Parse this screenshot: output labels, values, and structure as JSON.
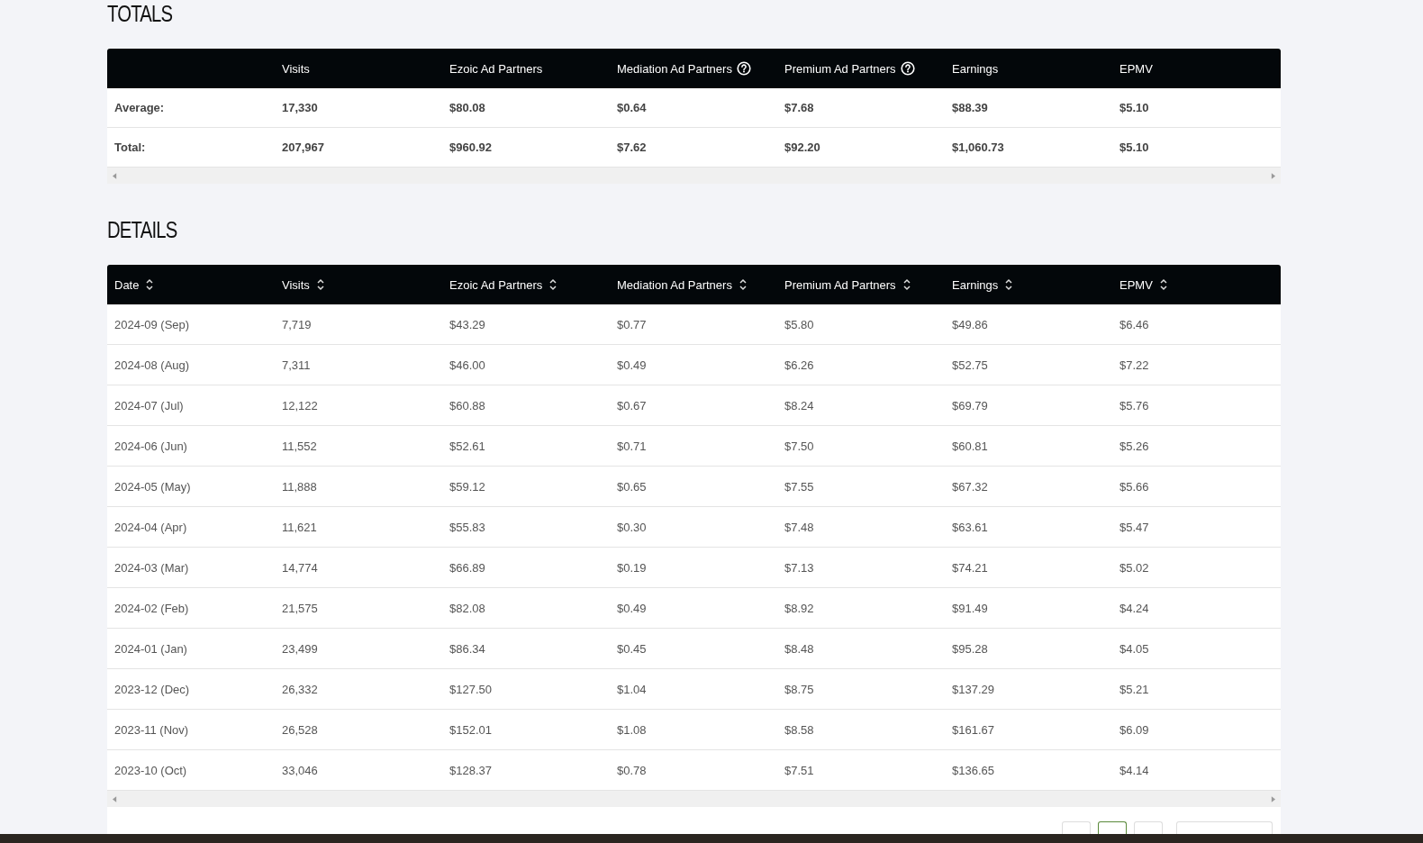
{
  "totals": {
    "title": "TOTALS",
    "columns": [
      {
        "help": false
      },
      {
        "label": "Visits",
        "help": false
      },
      {
        "label": "Ezoic Ad Partners",
        "help": false
      },
      {
        "label": "Mediation Ad Partners",
        "help": true
      },
      {
        "label": "Premium Ad Partners",
        "help": true
      },
      {
        "label": "Earnings",
        "help": false
      },
      {
        "label": "EPMV",
        "help": false
      }
    ],
    "rows": [
      [
        "Average:",
        "17,330",
        "$80.08",
        "$0.64",
        "$7.68",
        "$88.39",
        "$5.10"
      ],
      [
        "Total:",
        "207,967",
        "$960.92",
        "$7.62",
        "$92.20",
        "$1,060.73",
        "$5.10"
      ]
    ]
  },
  "details": {
    "title": "DETAILS",
    "columns": [
      "Date",
      "Visits",
      "Ezoic Ad Partners",
      "Mediation Ad Partners",
      "Premium Ad Partners",
      "Earnings",
      "EPMV"
    ],
    "rows": [
      [
        "2024-09 (Sep)",
        "7,719",
        "$43.29",
        "$0.77",
        "$5.80",
        "$49.86",
        "$6.46"
      ],
      [
        "2024-08 (Aug)",
        "7,311",
        "$46.00",
        "$0.49",
        "$6.26",
        "$52.75",
        "$7.22"
      ],
      [
        "2024-07 (Jul)",
        "12,122",
        "$60.88",
        "$0.67",
        "$8.24",
        "$69.79",
        "$5.76"
      ],
      [
        "2024-06 (Jun)",
        "11,552",
        "$52.61",
        "$0.71",
        "$7.50",
        "$60.81",
        "$5.26"
      ],
      [
        "2024-05 (May)",
        "11,888",
        "$59.12",
        "$0.65",
        "$7.55",
        "$67.32",
        "$5.66"
      ],
      [
        "2024-04 (Apr)",
        "11,621",
        "$55.83",
        "$0.30",
        "$7.48",
        "$63.61",
        "$5.47"
      ],
      [
        "2024-03 (Mar)",
        "14,774",
        "$66.89",
        "$0.19",
        "$7.13",
        "$74.21",
        "$5.02"
      ],
      [
        "2024-02 (Feb)",
        "21,575",
        "$82.08",
        "$0.49",
        "$8.92",
        "$91.49",
        "$4.24"
      ],
      [
        "2024-01 (Jan)",
        "23,499",
        "$86.34",
        "$0.45",
        "$8.48",
        "$95.28",
        "$4.05"
      ],
      [
        "2023-12 (Dec)",
        "26,332",
        "$127.50",
        "$1.04",
        "$8.75",
        "$137.29",
        "$5.21"
      ],
      [
        "2023-11 (Nov)",
        "26,528",
        "$152.01",
        "$1.08",
        "$8.58",
        "$161.67",
        "$6.09"
      ],
      [
        "2023-10 (Oct)",
        "33,046",
        "$128.37",
        "$0.78",
        "$7.51",
        "$136.65",
        "$4.14"
      ]
    ]
  },
  "pagination": {
    "pages": [
      {
        "selected": false
      },
      {
        "selected": true
      },
      {
        "selected": false
      }
    ]
  }
}
